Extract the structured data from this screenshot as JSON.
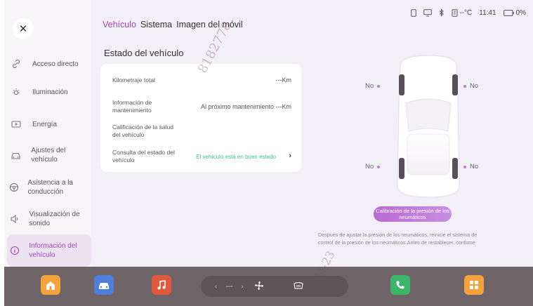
{
  "status_bar": {
    "temperature": "--°C",
    "time": "11:41",
    "battery": "0%"
  },
  "tabs": [
    {
      "label": "Vehículo",
      "active": true
    },
    {
      "label": "Sistema",
      "active": false
    },
    {
      "label": "Imagen del móvil",
      "active": false
    }
  ],
  "sidebar": {
    "items": [
      {
        "label": "Acceso directo",
        "icon": "link-icon"
      },
      {
        "label": "Iluminación",
        "icon": "sun-icon"
      },
      {
        "label": "Energía",
        "icon": "battery-icon"
      },
      {
        "label": "Ajustes del vehículo",
        "icon": "car-settings-icon"
      },
      {
        "label": "Asistencia a la conducción",
        "icon": "steering-wheel-icon"
      },
      {
        "label": "Visualización de sonido",
        "icon": "speaker-icon"
      },
      {
        "label": "Información del vehículo",
        "icon": "info-icon",
        "active": true
      }
    ]
  },
  "vehicle_status": {
    "title": "Estado del vehículo",
    "rows": [
      {
        "label": "Kilometraje total",
        "value": "---Km"
      },
      {
        "label": "Información de mantenimiento",
        "value": "Al próximo mantenimiento ---Km"
      },
      {
        "label": "Calificación de la salud del vehículo",
        "value": ""
      },
      {
        "label": "Consulta del estado del vehículo",
        "value": "El vehículo está en buen estado"
      }
    ]
  },
  "tires": {
    "front_left": "No",
    "front_right": "No",
    "rear_left": "No",
    "rear_right": "No"
  },
  "calibration_button": "Calibración de la presión de los neumáticos",
  "note_line1": "Después de ajustar la presión de los neumáticos, reinicie el sistema de",
  "note_line2": "control de la presión de los neumáticos.Antes de restablecer, confirme",
  "dock": {
    "climate_left_arrow": "‹",
    "climate_value": "---",
    "climate_right_arrow": "›"
  },
  "watermarks": [
    "8182778",
    "04-23"
  ],
  "colors": {
    "accent": "#a247b7",
    "ok": "#3dbfa6",
    "dock": "#6e6468"
  }
}
